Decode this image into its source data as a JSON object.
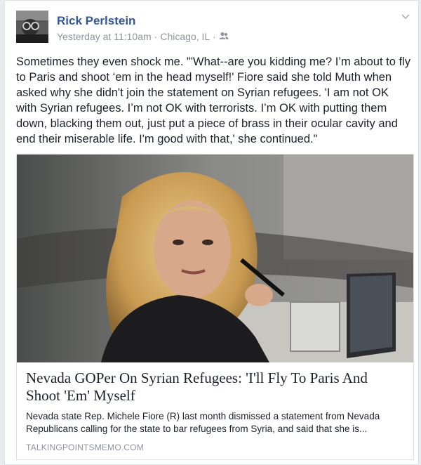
{
  "post": {
    "author": "Rick Perlstein",
    "timestamp": "Yesterday at 11:10am",
    "location": "Chicago, IL",
    "audience_icon": "friends-icon",
    "text": "Sometimes they even shock me. \"'What--are you kidding me? I’m about to fly to Paris and shoot ‘em in the head myself!' Fiore said she told Muth when asked why she didn't join the statement on Syrian refugees. 'I am not OK with Syrian refugees. I’m not OK with terrorists. I’m OK with putting them down, blacking them out, just put a piece of brass in their ocular cavity and end their miserable life. I'm good with that,' she continued.\""
  },
  "link_card": {
    "title": "Nevada GOPer On Syrian Refugees: 'I'll Fly To Paris And Shoot 'Em' Myself",
    "description": "Nevada state Rep. Michele Fiore (R) last month dismissed a statement from Nevada Republicans calling for the state to bar refugees from Syria, and said that she is...",
    "domain": "TALKINGPOINTSMEMO.COM"
  },
  "colors": {
    "author": "#365899",
    "meta": "#90949c",
    "text": "#1d2129",
    "border": "#dddfe2"
  }
}
